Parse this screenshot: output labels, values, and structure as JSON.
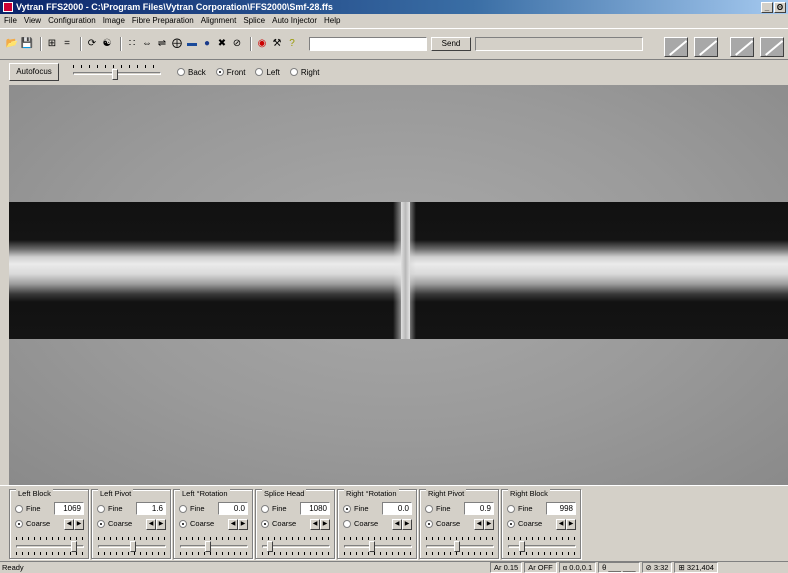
{
  "window": {
    "title": "Vytran FFS2000 - C:\\Program Files\\Vytran Corporation\\FFS2000\\Smf-28.ffs",
    "buttons": [
      "_",
      "ʘ"
    ]
  },
  "menu": [
    "File",
    "View",
    "Configuration",
    "Image",
    "Fibre Preparation",
    "Alignment",
    "Splice",
    "Auto Injector",
    "Help"
  ],
  "toolbar": {
    "icons": [
      "open-icon",
      "save-icon",
      "zoom-icon",
      "equals-icon",
      "rotate-icon",
      "move-icon",
      "align-icon",
      "gap-icon",
      "split-icon",
      "target-icon",
      "fiber-icon",
      "record-icon",
      "cross-icon",
      "stop-icon",
      "arc-icon",
      "wrench-icon",
      "help-icon"
    ],
    "command_value": "",
    "send_label": "Send",
    "response_value": ""
  },
  "focus": {
    "autofocus_label": "Autofocus",
    "slider_level_pct": 48,
    "views": [
      {
        "label": "Back",
        "selected": false
      },
      {
        "label": "Front",
        "selected": true
      },
      {
        "label": "Left",
        "selected": false
      },
      {
        "label": "Right",
        "selected": false
      }
    ]
  },
  "controls": [
    {
      "title": "Left Block",
      "value": "1069",
      "fine_label": "Fine",
      "coarse_label": "Coarse",
      "mode": "Coarse",
      "slider_pct": 88
    },
    {
      "title": "Left Pivot",
      "value": "1.6",
      "fine_label": "Fine",
      "coarse_label": "Coarse",
      "mode": "Coarse",
      "slider_pct": 52
    },
    {
      "title": "Left °Rotation",
      "value": "0.0",
      "fine_label": "Fine",
      "coarse_label": "Coarse",
      "mode": "Coarse",
      "slider_pct": 40
    },
    {
      "title": "Splice Head",
      "value": "1080",
      "fine_label": "Fine",
      "coarse_label": "Coarse",
      "mode": "Coarse",
      "slider_pct": 8
    },
    {
      "title": "Right °Rotation",
      "value": "0.0",
      "fine_label": "Fine",
      "coarse_label": "Coarse",
      "mode": "Fine",
      "slider_pct": 40
    },
    {
      "title": "Right Pivot",
      "value": "0.9",
      "fine_label": "Fine",
      "coarse_label": "Coarse",
      "mode": "Coarse",
      "slider_pct": 45
    },
    {
      "title": "Right Block",
      "value": "998",
      "fine_label": "Fine",
      "coarse_label": "Coarse",
      "mode": "Coarse",
      "slider_pct": 18
    }
  ],
  "status": {
    "ready": "Ready",
    "panels": [
      "Ar 0.15",
      "Ar OFF",
      "α 0.0,0.1",
      "θ ___ ___",
      "⊘ 3:32",
      "⊞ 321,404"
    ]
  }
}
